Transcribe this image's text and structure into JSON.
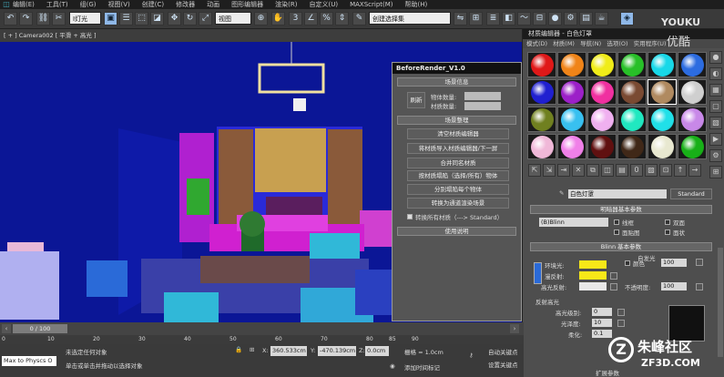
{
  "menubar": {
    "items": [
      "编辑(E)",
      "工具(T)",
      "组(G)",
      "视图(V)",
      "创建(C)",
      "修改器",
      "动画",
      "图形编辑器",
      "渲染(R)",
      "自定义(U)",
      "MAXScript(M)",
      "帮助(H)"
    ]
  },
  "toolbar": {
    "filter": "Ⅰ灯光",
    "view": "视图",
    "selection_set": "创建选择集"
  },
  "viewport": {
    "label": "[ + ] Camera002 [ 平滑 + 高光 ]"
  },
  "before_render": {
    "title": "BeforeRender_V1.0",
    "scene_info": "场景信息",
    "refresh": "刷新",
    "object_count": "物体数量:",
    "material_count": "材质数量:",
    "scene_organize": "场景整理",
    "buttons": [
      "清空材质编辑器",
      "将材质导入材质编辑器/下一屏",
      "合并同名材质",
      "按材质塌陷（选择/所有）物体",
      "分别塌陷每个物体",
      "转换为通道渲染场景"
    ],
    "convert_all": "转换所有材质（---> Standard）",
    "help": "使用说明"
  },
  "material_editor": {
    "title": "材质编辑器 - 白色灯罩",
    "menus": [
      "模式(D)",
      "材质(M)",
      "导航(N)",
      "选项(O)",
      "实用程序(U)"
    ],
    "slot_colors": [
      "#e01818",
      "#f08418",
      "#f0ec18",
      "#28c028",
      "#18d8e8",
      "#2c6ce0",
      "#2020d0",
      "#9c20c8",
      "#f030a0",
      "#7a4a32",
      "#b08a60",
      "#cfcfcf",
      "#708020",
      "#38c0f0",
      "#f0b0f0",
      "#20e8c0",
      "#20e0e8",
      "#c888e8",
      "#f0b8d8",
      "#f080e8",
      "#601010",
      "#402818",
      "#e8e8d0",
      "#18b018"
    ],
    "material_name": "白色灯罩",
    "material_type": "Standard",
    "shader_params": "明暗器基本参数",
    "shader": "(B)Blinn",
    "wire": "线框",
    "two_sided": "双面",
    "face_map": "面贴图",
    "faceted": "面状",
    "blinn_params": "Blinn 基本参数",
    "self_illum": "自发光",
    "color_label": "颜色",
    "color_value": "100",
    "ambient": "环境光:",
    "diffuse": "漫反射:",
    "specular": "高光反射:",
    "opacity": "不透明度:",
    "opacity_value": "100",
    "highlights": "反射高光",
    "spec_level": "高光级别:",
    "spec_level_value": "0",
    "glossiness": "光泽度:",
    "glossiness_value": "10",
    "soften": "柔化:",
    "soften_value": "0.1",
    "extended": "扩展参数",
    "toolbar_icons": [
      "sphere",
      "backlight",
      "checker",
      "sample-uv",
      "video",
      "options",
      "sort",
      "grid",
      "pick"
    ],
    "bottom_icons": [
      "get-material",
      "put",
      "assign",
      "reset",
      "copy",
      "unique",
      "library",
      "id",
      "show-map",
      "show-end",
      "go-parent",
      "go-sibling"
    ]
  },
  "timeline": {
    "frame": "0 / 100",
    "ticks": [
      "0",
      "10",
      "20",
      "30",
      "40",
      "50",
      "60",
      "70",
      "80",
      "85",
      "90"
    ]
  },
  "status": {
    "script": "Max to Physcs O",
    "no_selection": "未选定任何对象",
    "hint": "单击或单击并拖动以选择对象",
    "x": "360.533cm",
    "y": "-470.139cm",
    "z": "0.0cm",
    "grid": "栅格 = 1.0cm",
    "add_time_tag": "添加时间标记",
    "auto_key": "自动关键点",
    "set_key": "设置关键点"
  },
  "watermark": {
    "text1": "YOUKU",
    "text2": "优酷",
    "text3": "朱峰社区",
    "text4": "ZF3D.COM"
  }
}
